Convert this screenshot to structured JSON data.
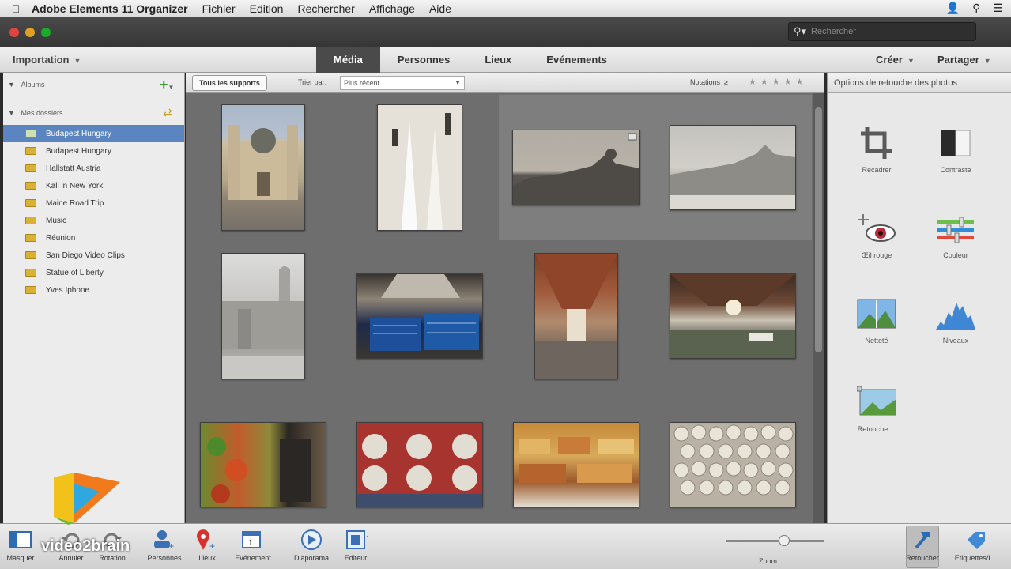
{
  "menubar": {
    "app_name": "Adobe Elements 11 Organizer",
    "menus": [
      "Fichier",
      "Edition",
      "Rechercher",
      "Affichage",
      "Aide"
    ]
  },
  "titlebar": {
    "search_placeholder": "Rechercher"
  },
  "toolbar": {
    "import_label": "Importation",
    "tabs": [
      {
        "label": "Média",
        "active": true
      },
      {
        "label": "Personnes",
        "active": false
      },
      {
        "label": "Lieux",
        "active": false
      },
      {
        "label": "Evénements",
        "active": false
      }
    ],
    "create_label": "Créer",
    "share_label": "Partager"
  },
  "leftpanel": {
    "albums_label": "Albums",
    "folders_label": "Mes dossiers",
    "folders": [
      {
        "label": "Budapest Hungary",
        "selected": true
      },
      {
        "label": "Budapest Hungary",
        "selected": false
      },
      {
        "label": "Hallstatt Austria",
        "selected": false
      },
      {
        "label": "Kali in New York",
        "selected": false
      },
      {
        "label": "Maine Road Trip",
        "selected": false
      },
      {
        "label": "Music",
        "selected": false
      },
      {
        "label": "Réunion",
        "selected": false
      },
      {
        "label": "San Diego Video Clips",
        "selected": false
      },
      {
        "label": "Statue of Liberty",
        "selected": false
      },
      {
        "label": "Yves Iphone",
        "selected": false
      }
    ]
  },
  "subbar": {
    "all_media_label": "Tous les supports",
    "sort_label": "Trier par:",
    "sort_value": "Plus récent",
    "ratings_label": "Notations",
    "ratings_operator": "≥",
    "stars": "★★★★★"
  },
  "rightpanel": {
    "header": "Options de retouche des photos",
    "tools": [
      {
        "label": "Recadrer",
        "icon": "crop-icon"
      },
      {
        "label": "Contraste",
        "icon": "contrast-icon"
      },
      {
        "label": "Œil rouge",
        "icon": "red-eye-icon"
      },
      {
        "label": "Couleur",
        "icon": "color-icon"
      },
      {
        "label": "Netteté",
        "icon": "sharpen-icon"
      },
      {
        "label": "Niveaux",
        "icon": "levels-icon"
      },
      {
        "label": "Retouche ...",
        "icon": "retouch-icon"
      }
    ]
  },
  "bottombar": {
    "items": [
      {
        "label": "Masquer",
        "icon": "hide-panel-icon"
      },
      {
        "label": "Annuler",
        "icon": "undo-icon"
      },
      {
        "label": "Rotation",
        "icon": "rotate-icon"
      },
      {
        "label": "Personnes",
        "icon": "people-icon"
      },
      {
        "label": "Lieux",
        "icon": "place-pin-icon"
      },
      {
        "label": "Evénement",
        "icon": "event-icon"
      },
      {
        "label": "Diaporama",
        "icon": "play-icon"
      },
      {
        "label": "Editeur",
        "icon": "editor-icon"
      }
    ],
    "zoom_label": "Zoom",
    "zoom_level": 0.6,
    "retouch_label": "Retoucher",
    "tags_label": "Etiquettes/I..."
  },
  "watermark": {
    "text": "video2brain"
  },
  "colors": {
    "selection_blue": "#5b85c0",
    "active_tab": "#4a4a4a",
    "grid_bg": "#6e6e6e"
  }
}
